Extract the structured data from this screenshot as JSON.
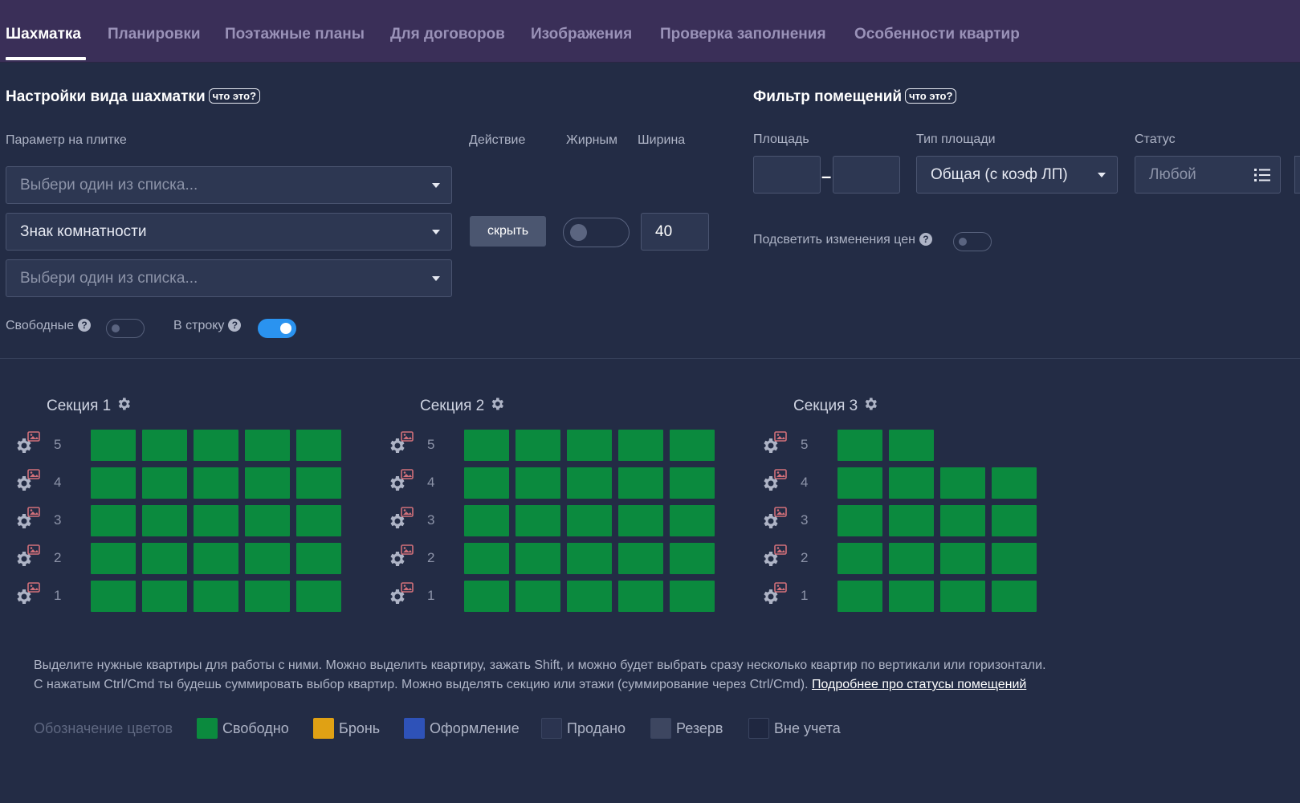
{
  "tabs": [
    {
      "label": "Шахматка",
      "active": true
    },
    {
      "label": "Планировки",
      "active": false
    },
    {
      "label": "Поэтажные планы",
      "active": false
    },
    {
      "label": "Для договоров",
      "active": false
    },
    {
      "label": "Изображения",
      "active": false
    },
    {
      "label": "Проверка заполнения",
      "active": false
    },
    {
      "label": "Особенности квартир",
      "active": false
    }
  ],
  "settings": {
    "title": "Настройки вида шахматки",
    "what_label": "что это?",
    "param_label": "Параметр на плитке",
    "action_label": "Действие",
    "bold_label": "Жирным",
    "width_label": "Ширина",
    "selects": [
      "Выбери один из списка...",
      "Знак комнатности",
      "Выбери один из списка..."
    ],
    "hide_button": "скрыть",
    "width_value": "40",
    "free_label": "Свободные",
    "row_label": "В строку"
  },
  "filter": {
    "title": "Фильтр помещений",
    "what_label": "что это?",
    "area_label": "Площадь",
    "area_type_label": "Тип площади",
    "area_type_value": "Общая (с коэф ЛП)",
    "status_label": "Статус",
    "status_placeholder": "Любой",
    "highlight_label": "Подсветить изменения цен"
  },
  "sections": [
    {
      "title": "Секция 1",
      "floors": [
        5,
        4,
        3,
        2,
        1
      ],
      "cells": [
        5,
        5,
        5,
        5,
        5
      ]
    },
    {
      "title": "Секция 2",
      "floors": [
        5,
        4,
        3,
        2,
        1
      ],
      "cells": [
        5,
        5,
        5,
        5,
        5
      ]
    },
    {
      "title": "Секция 3",
      "floors": [
        5,
        4,
        3,
        2,
        1
      ],
      "cells": [
        2,
        4,
        4,
        4,
        4
      ]
    }
  ],
  "help": {
    "line1": "Выделите нужные квартиры для работы с ними. Можно выделить квартиру, зажать Shift, и можно будет выбрать сразу несколько квартир по вертикали или горизонтали.",
    "line2": "С нажатым Ctrl/Cmd ты будешь суммировать выбор квартир. Можно выделять секцию или этажи (суммирование через Ctrl/Cmd).",
    "link": "Подробнее про статусы помещений"
  },
  "legend": {
    "title": "Обозначение цветов",
    "items": [
      {
        "label": "Свободно",
        "color": "#0b8a3e"
      },
      {
        "label": "Бронь",
        "color": "#e0a114"
      },
      {
        "label": "Оформление",
        "color": "#2e52b8"
      },
      {
        "label": "Продано",
        "color": "#2b3450"
      },
      {
        "label": "Резерв",
        "color": "#3d4660"
      },
      {
        "label": "Вне учета",
        "color": "#1f2740"
      }
    ]
  },
  "colors": {
    "free": "#0b8a3e",
    "nav_bg": "#3a2f58",
    "page_bg": "#232c45",
    "toggle_on": "#2a93f0"
  }
}
